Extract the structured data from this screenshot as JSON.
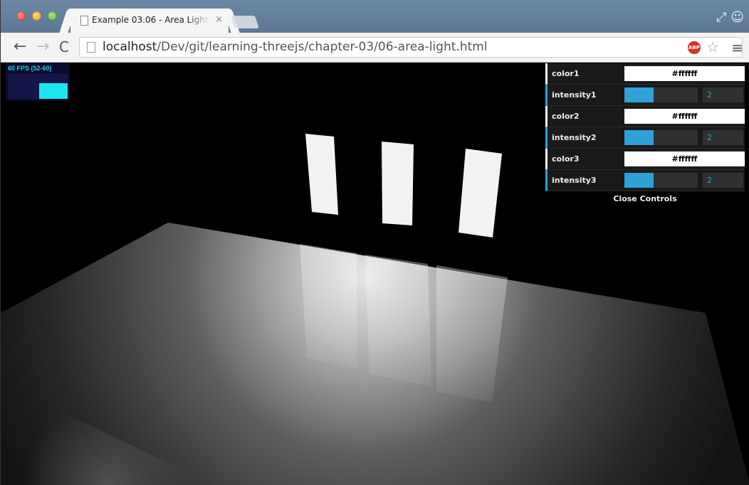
{
  "browser": {
    "tab_title": "Example 03.06 - Area Light",
    "tab_close": "×",
    "url_host": "localhost",
    "url_path": "/Dev/git/learning-threejs/chapter-03/06-area-light.html",
    "nav": {
      "back": "←",
      "forward": "→",
      "reload": "C"
    },
    "icons": {
      "adblock": "ABP",
      "star": "☆",
      "menu": "≡"
    }
  },
  "stats": {
    "fps_text": "60 FPS (52-60)",
    "fps_fill": 0.6
  },
  "gui": {
    "rows": [
      {
        "label": "color1",
        "type": "color",
        "value": "#ffffff"
      },
      {
        "label": "intensity1",
        "type": "number",
        "value": "2",
        "fill": 0.4
      },
      {
        "label": "color2",
        "type": "color",
        "value": "#ffffff"
      },
      {
        "label": "intensity2",
        "type": "number",
        "value": "2",
        "fill": 0.4
      },
      {
        "label": "color3",
        "type": "color",
        "value": "#ffffff"
      },
      {
        "label": "intensity3",
        "type": "number",
        "value": "2",
        "fill": 0.4
      }
    ],
    "close_label": "Close Controls"
  },
  "colors": {
    "accent": "#2fa1d6",
    "stats_fps": "#1ecfe6"
  }
}
